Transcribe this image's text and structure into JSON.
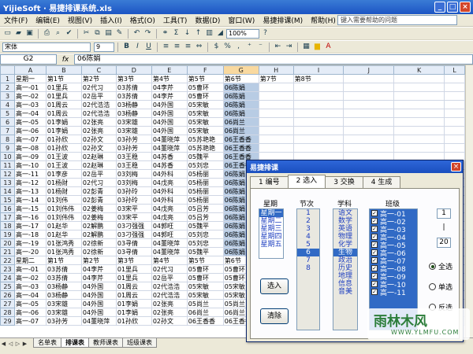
{
  "window": {
    "title": "YijieSoft · 易捷排课系统.xls",
    "min": "_",
    "max": "□",
    "close": "×"
  },
  "menu": {
    "items": [
      "文件(F)",
      "编辑(E)",
      "视图(V)",
      "插入(I)",
      "格式(O)",
      "工具(T)",
      "数据(D)",
      "窗口(W)",
      "易捷排课(M)",
      "帮助(H)"
    ],
    "help_placeholder": "键入需要帮助的问题"
  },
  "toolbar": {
    "zoom": "100%",
    "font": "宋体",
    "size": "9",
    "bold": "B",
    "italic": "I",
    "underline": "U"
  },
  "formula": {
    "cell": "G2",
    "fx": "fx",
    "value": "06陈娟"
  },
  "grid": {
    "columns": [
      "A",
      "B",
      "C",
      "D",
      "E",
      "F",
      "G",
      "H",
      "I",
      "J",
      "K",
      "L"
    ],
    "rows": [
      [
        "1",
        "星期一",
        "第1节",
        "第2节",
        "第3节",
        "第4节",
        "第5节",
        "第6节",
        "第7节",
        "第8节"
      ],
      [
        "2",
        "高一-01",
        "01里兵",
        "02代习",
        "03苏倩",
        "04李芹",
        "05曹环",
        "06陈娟",
        "",
        "",
        ""
      ],
      [
        "3",
        "高一-02",
        "01里兵",
        "02岳平",
        "03苏倩",
        "04李芹",
        "05曹环",
        "06陈娟",
        "",
        "",
        ""
      ],
      [
        "4",
        "高一-03",
        "01周云",
        "02代浩浩",
        "03杨静",
        "04外国",
        "05宋敏",
        "06陈娟",
        "",
        "",
        ""
      ],
      [
        "5",
        "高一-04",
        "01周云",
        "02代浩浩",
        "03杨静",
        "04外国",
        "05宋敏",
        "06陈娟",
        "",
        "",
        ""
      ],
      [
        "6",
        "高一-05",
        "01李娟",
        "02张亮",
        "03宋雄",
        "04外国",
        "05宋敏",
        "06尚兰",
        "",
        "",
        ""
      ],
      [
        "7",
        "高一-06",
        "01李娟",
        "02张亮",
        "03宋雄",
        "04外国",
        "05宋敏",
        "06尚兰",
        "",
        "",
        ""
      ],
      [
        "8",
        "高一-07",
        "01孙欣",
        "02孙文",
        "03孙芳",
        "04董晓萍",
        "05苏艳艳",
        "06王香香",
        "",
        "",
        ""
      ],
      [
        "9",
        "高一-08",
        "01孙欣",
        "02孙文",
        "03孙芳",
        "04董晓萍",
        "05苏艳艳",
        "06王香香",
        "",
        "",
        ""
      ],
      [
        "10",
        "高一-09",
        "01王波",
        "02赵琳",
        "03王稳",
        "04苏香",
        "05魏平",
        "06王香香",
        "",
        "",
        ""
      ],
      [
        "11",
        "高一-10",
        "01王波",
        "02赵琳",
        "03王稳",
        "04苏香",
        "05刘忠",
        "06王香香",
        "",
        "",
        ""
      ],
      [
        "12",
        "高一-11",
        "01李彦",
        "02岳平",
        "03刘梅",
        "04外科",
        "05杨丽",
        "06陈娟",
        "",
        "",
        ""
      ],
      [
        "13",
        "高一-12",
        "01杨财",
        "02代习",
        "03刘梅",
        "04戊亮",
        "05杨丽",
        "06陈娟",
        "",
        "",
        ""
      ],
      [
        "14",
        "高一-13",
        "01杨财",
        "02彭青",
        "03孙玲",
        "04外科",
        "05杨丽",
        "06陈娟",
        "",
        "",
        ""
      ],
      [
        "15",
        "高一-14",
        "01刘伟",
        "02彭青",
        "03孙玲",
        "04外科",
        "05杨丽",
        "06陈娟",
        "",
        "",
        ""
      ],
      [
        "16",
        "高一-15",
        "01刘伟伟",
        "02姜梅",
        "03宋平",
        "04戊亮",
        "05吕芳",
        "06陈娟",
        "",
        "",
        ""
      ],
      [
        "17",
        "高一-16",
        "01刘伟伟",
        "02姜梅",
        "03宋平",
        "04戊亮",
        "05吕芳",
        "06陈娟",
        "",
        "",
        ""
      ],
      [
        "18",
        "高一-17",
        "01赵华",
        "02解鹏",
        "03刁强强",
        "04郭旺",
        "05魏平",
        "06陈娟",
        "",
        "",
        ""
      ],
      [
        "19",
        "高一-18",
        "01赵华",
        "02解鹏",
        "03刁强强",
        "04郭旺",
        "05刘忠",
        "06陈娟",
        "",
        "",
        ""
      ],
      [
        "20",
        "高一-19",
        "01张鸿秀",
        "02徐新",
        "03寻倩",
        "04董晓萍",
        "05刘忠",
        "06陈娟",
        "",
        "",
        ""
      ],
      [
        "21",
        "高一-20",
        "01张鸿秀",
        "02徐新",
        "03寻倩",
        "04董晓萍",
        "05魏平",
        "06陈娟",
        "",
        "",
        ""
      ],
      [
        "22",
        "星期二",
        "第1节",
        "第2节",
        "第3节",
        "第4节",
        "第5节",
        "第6节",
        "",
        "",
        ""
      ],
      [
        "23",
        "高一-01",
        "03苏倩",
        "04李芹",
        "01里兵",
        "02代习",
        "05曹环",
        "05曹环",
        "",
        "",
        ""
      ],
      [
        "24",
        "高一-02",
        "03苏倩",
        "04李芹",
        "01里兵",
        "02岳平",
        "05曹环",
        "05曹环",
        "",
        "",
        ""
      ],
      [
        "25",
        "高一-03",
        "03杨静",
        "04外国",
        "01周云",
        "02代浩浩",
        "05宋敏",
        "05宋敏",
        "",
        "",
        ""
      ],
      [
        "26",
        "高一-04",
        "03杨静",
        "04外国",
        "01周云",
        "02代浩浩",
        "05宋敏",
        "05宋敏",
        "",
        "",
        ""
      ],
      [
        "27",
        "高一-05",
        "03宋雄",
        "04外国",
        "01李娟",
        "02张亮",
        "05尚兰",
        "05尚兰",
        "",
        "",
        ""
      ],
      [
        "28",
        "高一-06",
        "03宋雄",
        "04外国",
        "01李娟",
        "02张亮",
        "06尚兰",
        "06尚兰",
        "",
        "",
        ""
      ],
      [
        "29",
        "高一-07",
        "03孙芳",
        "04董晓萍",
        "01孙欣",
        "02孙文",
        "06王香香",
        "06王香香",
        "",
        "",
        ""
      ]
    ]
  },
  "tabs": [
    "名单表",
    "排课表",
    "教师课表",
    "班级课表"
  ],
  "dialog": {
    "title": "易捷排课",
    "close": "×",
    "tabs": [
      "1 编号",
      "2 选入",
      "3 交换",
      "4 生成"
    ],
    "headers": {
      "weekday": "星期",
      "period": "节次",
      "subject": "学科",
      "class": "班级"
    },
    "weekdays": [
      "星期一",
      "星期二",
      "星期三",
      "星期四",
      "星期五"
    ],
    "periods": [
      "1",
      "2",
      "3",
      "4",
      "5",
      "6",
      "7",
      "8"
    ],
    "subjects": [
      "语文",
      "数学",
      "英语",
      "物理",
      "化学",
      "生物",
      "政治",
      "历史",
      "地理",
      "信息",
      "音美"
    ],
    "classes": [
      "高一-01",
      "高一-02",
      "高一-03",
      "高一-04",
      "高一-05",
      "高一-06",
      "高一-07",
      "高一-08",
      "高一-09",
      "高一-10",
      "高一-11"
    ],
    "check": "✓",
    "select_button": "选入",
    "clear_button": "清除",
    "range_from": "1",
    "range_to": "20",
    "range_sep": "|",
    "radio": {
      "all": "全选",
      "single": "单选",
      "invert": "反选"
    }
  },
  "watermark": {
    "main": "雨林木风",
    "sub": "WWW.YLMFU.COM"
  }
}
